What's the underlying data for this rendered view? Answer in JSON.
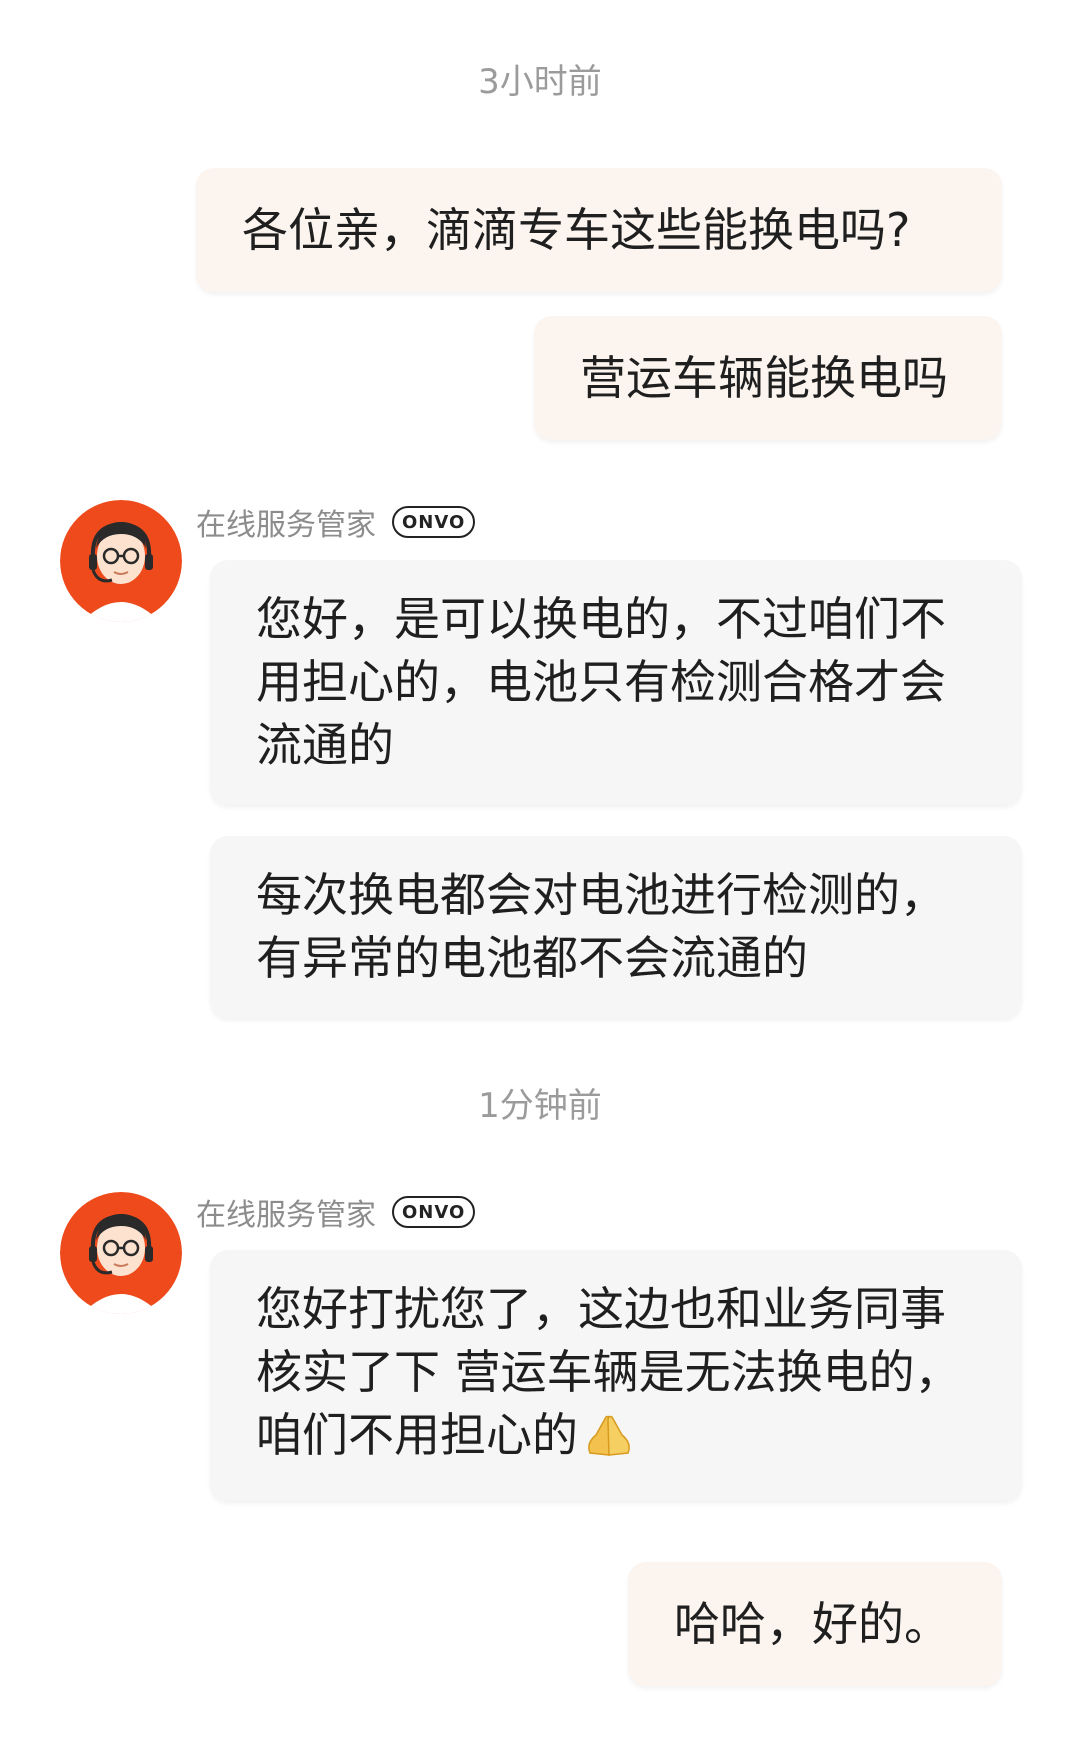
{
  "timestamps": {
    "first": "3小时前",
    "second": "1分钟前"
  },
  "messages": {
    "out1": "各位亲，滴滴专车这些能换电吗?",
    "out2": "营运车辆能换电吗",
    "in1": "您好，是可以换电的，不过咱们不用担心的，电池只有检测合格才会流通的",
    "in2": "每次换电都会对电池进行检测的，有异常的电池都不会流通的",
    "in3": "您好打扰您了，这边也和业务同事核实了下  营运车辆是无法换电的，咱们不用担心的",
    "out3": "哈哈，好的。"
  },
  "sender": {
    "name": "在线服务管家",
    "badge": "ONVO"
  },
  "icons": {
    "avatar": "customer-service-agent-avatar",
    "emoji": "praying-hands-icon"
  },
  "colors": {
    "avatar_bg": "#ee4a1c",
    "outgoing_bubble": "#fbf4ef",
    "incoming_bubble": "#f6f6f6",
    "timestamp": "#9b9b9b"
  }
}
